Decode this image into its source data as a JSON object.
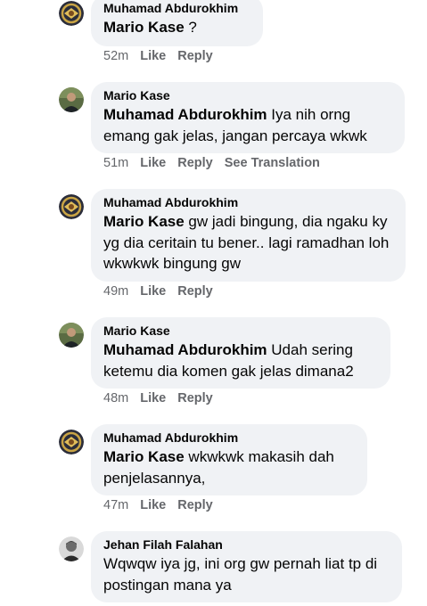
{
  "comments": [
    {
      "author": "Muhamad Abdurokhim",
      "avatar": "gold-emblem-avatar",
      "mention": "Mario Kase",
      "text": " ?",
      "time": "52m",
      "like": "Like",
      "reply": "Reply",
      "translate": ""
    },
    {
      "author": "Mario Kase",
      "avatar": "person-photo-avatar",
      "mention": "Muhamad Abdurokhim",
      "text": " Iya nih orng emang gak jelas, jangan percaya wkwk",
      "time": "51m",
      "like": "Like",
      "reply": "Reply",
      "translate": "See Translation"
    },
    {
      "author": "Muhamad Abdurokhim",
      "avatar": "gold-emblem-avatar",
      "mention": "Mario Kase",
      "text": " gw jadi bingung, dia ngaku ky yg dia ceritain tu bener.. lagi ramadhan loh wkwkwk bingung gw",
      "time": "49m",
      "like": "Like",
      "reply": "Reply",
      "translate": ""
    },
    {
      "author": "Mario Kase",
      "avatar": "person-photo-avatar",
      "mention": "Muhamad Abdurokhim",
      "text": " Udah sering ketemu dia komen gak jelas dimana2",
      "time": "48m",
      "like": "Like",
      "reply": "Reply",
      "translate": ""
    },
    {
      "author": "Muhamad Abdurokhim",
      "avatar": "gold-emblem-avatar",
      "mention": "Mario Kase",
      "text": " wkwkwk makasih dah penjelasannya,",
      "time": "47m",
      "like": "Like",
      "reply": "Reply",
      "translate": ""
    },
    {
      "author": "Jehan Filah Falahan",
      "avatar": "person-bw-avatar",
      "mention": "",
      "text": "Wqwqw iya jg, ini org gw pernah liat tp di postingan mana ya",
      "time": "",
      "like": "",
      "reply": "",
      "translate": ""
    }
  ]
}
